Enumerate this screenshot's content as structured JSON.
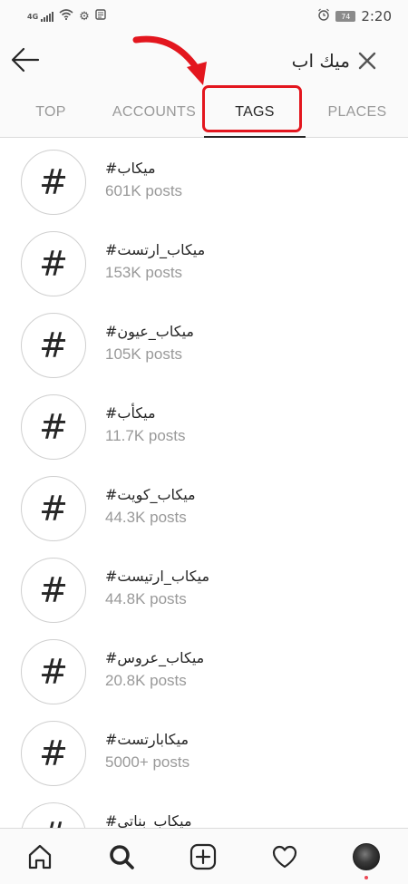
{
  "status_bar": {
    "network": "4G",
    "battery": "74",
    "time": "2:20",
    "icons": [
      "signal-icon",
      "wifi-icon",
      "settings-icon",
      "notification-icon",
      "alarm-icon",
      "battery-icon"
    ]
  },
  "search": {
    "query": "ميك اب",
    "back_icon": "arrow-left-icon",
    "clear_icon": "close-icon"
  },
  "tabs": [
    {
      "label": "TOP",
      "active": false
    },
    {
      "label": "ACCOUNTS",
      "active": false
    },
    {
      "label": "TAGS",
      "active": true
    },
    {
      "label": "PLACES",
      "active": false
    }
  ],
  "annotation": {
    "color": "#e3161e",
    "target": "TAGS"
  },
  "results": [
    {
      "name": "#ميكاب",
      "count": "601K posts"
    },
    {
      "name": "#ميكاب_ارتست",
      "count": "153K posts"
    },
    {
      "name": "#ميكاب_عيون",
      "count": "105K posts"
    },
    {
      "name": "#ميكأب",
      "count": "11.7K posts"
    },
    {
      "name": "#ميكاب_كويت",
      "count": "44.3K posts"
    },
    {
      "name": "#ميكاب_ارتيست",
      "count": "44.8K posts"
    },
    {
      "name": "#ميكاب_عروس",
      "count": "20.8K posts"
    },
    {
      "name": "#ميكابارتست",
      "count": "5000+ posts"
    },
    {
      "name": "#ميكاب_بناتي",
      "count": ""
    }
  ],
  "hash_symbol": "#",
  "bottom_nav": [
    {
      "name": "home-icon"
    },
    {
      "name": "search-icon",
      "active": true
    },
    {
      "name": "add-icon"
    },
    {
      "name": "heart-icon"
    },
    {
      "name": "profile-avatar"
    }
  ],
  "colors": {
    "text": "#262626",
    "secondary": "#999999",
    "divider": "#dbdbdb",
    "accent": "#ed4956"
  }
}
